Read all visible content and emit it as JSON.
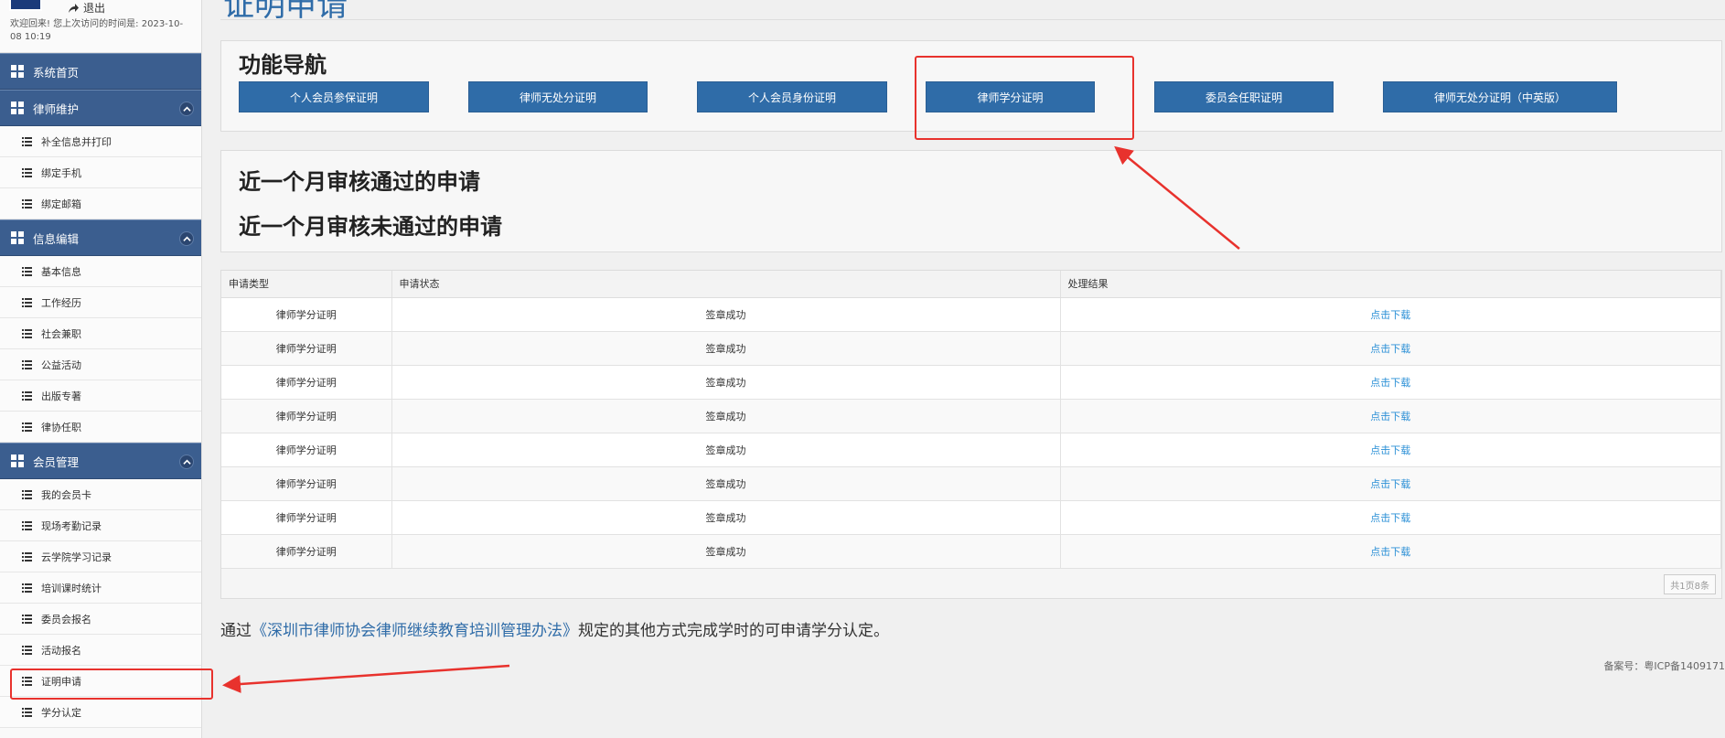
{
  "user": {
    "logout_label": "退出",
    "welcome_text": "欢迎回来! 您上次访问的时间是: 2023-10-08 10:19"
  },
  "sidebar": {
    "home_label": "系统首页",
    "groups": [
      {
        "label": "律师维护",
        "items": [
          "补全信息并打印",
          "绑定手机",
          "绑定邮箱"
        ]
      },
      {
        "label": "信息编辑",
        "items": [
          "基本信息",
          "工作经历",
          "社会兼职",
          "公益活动",
          "出版专著",
          "律协任职"
        ]
      },
      {
        "label": "会员管理",
        "items": [
          "我的会员卡",
          "现场考勤记录",
          "云学院学习记录",
          "培训课时统计",
          "委员会报名",
          "活动报名",
          "证明申请",
          "学分认定"
        ]
      }
    ]
  },
  "main": {
    "page_title": "证明申请",
    "nav_heading": "功能导航",
    "nav_buttons": [
      "个人会员参保证明",
      "律师无处分证明",
      "个人会员身份证明",
      "律师学分证明",
      "委员会任职证明",
      "律师无处分证明（中英版）"
    ],
    "recent_pass": "近一个月审核通过的申请",
    "recent_fail": "近一个月审核未通过的申请",
    "table": {
      "headers": [
        "申请类型",
        "申请状态",
        "处理结果"
      ],
      "rows": [
        [
          "律师学分证明",
          "签章成功",
          "点击下载"
        ],
        [
          "律师学分证明",
          "签章成功",
          "点击下载"
        ],
        [
          "律师学分证明",
          "签章成功",
          "点击下载"
        ],
        [
          "律师学分证明",
          "签章成功",
          "点击下载"
        ],
        [
          "律师学分证明",
          "签章成功",
          "点击下载"
        ],
        [
          "律师学分证明",
          "签章成功",
          "点击下载"
        ],
        [
          "律师学分证明",
          "签章成功",
          "点击下载"
        ],
        [
          "律师学分证明",
          "签章成功",
          "点击下载"
        ]
      ],
      "pager": "共1页8条"
    },
    "notice_prefix": "通过",
    "notice_link": "《深圳市律师协会律师继续教育培训管理办法》",
    "notice_suffix": "规定的其他方式完成学时的可申请学分认定。",
    "icp": "备案号：粤ICP备1409171"
  },
  "colors": {
    "nav_header": "#3b5e8f",
    "button": "#2f6ca8",
    "link": "#2a8fd6",
    "annotation": "#e8322d"
  }
}
